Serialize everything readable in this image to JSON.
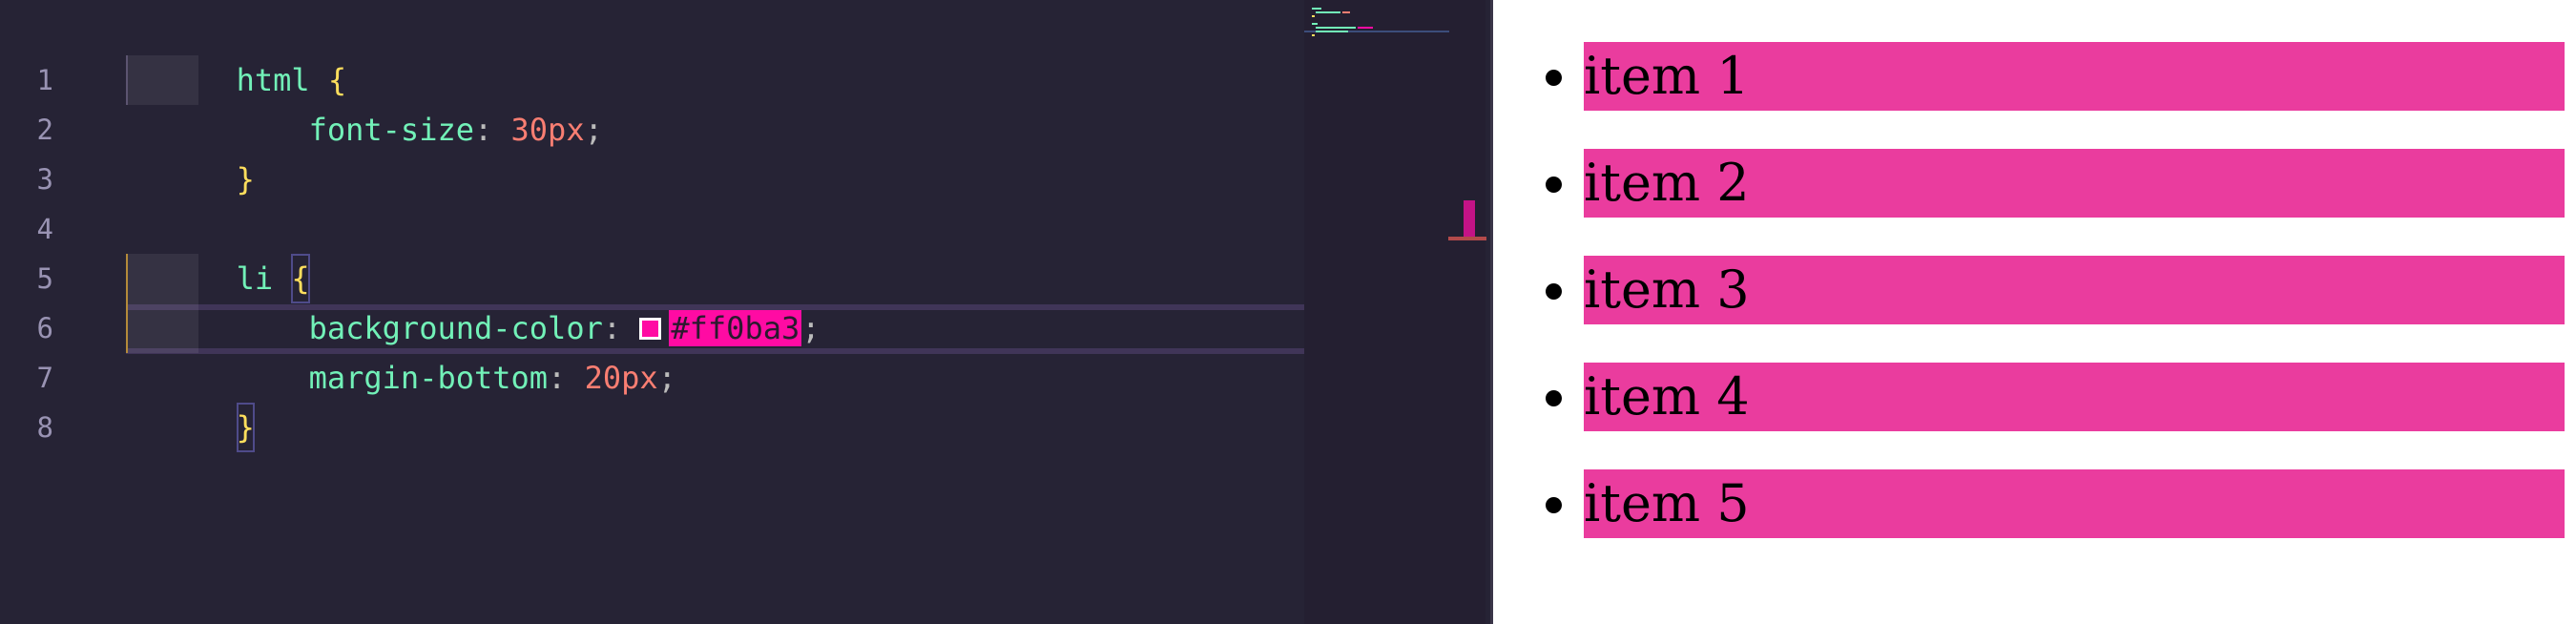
{
  "editor": {
    "line_numbers": [
      "1",
      "2",
      "3",
      "4",
      "5",
      "6",
      "7",
      "8"
    ],
    "lines": {
      "l1_selector": "html",
      "l1_brace": "{",
      "l2_prop": "font-size",
      "l2_colon": ": ",
      "l2_value": "30px",
      "l2_semi": ";",
      "l3_brace": "}",
      "l5_selector": "li",
      "l5_brace": "{",
      "l6_prop": "background-color",
      "l6_colon": ": ",
      "l6_value": "#ff0ba3",
      "l6_semi": ";",
      "l7_prop": "margin-bottom",
      "l7_colon": ": ",
      "l7_value": "20px",
      "l7_semi": ";",
      "l8_brace": "}"
    },
    "swatch_color": "#ff0ba3"
  },
  "preview": {
    "items": [
      "item 1",
      "item 2",
      "item 3",
      "item 4",
      "item 5"
    ],
    "item_background": "#ea3c9e"
  }
}
